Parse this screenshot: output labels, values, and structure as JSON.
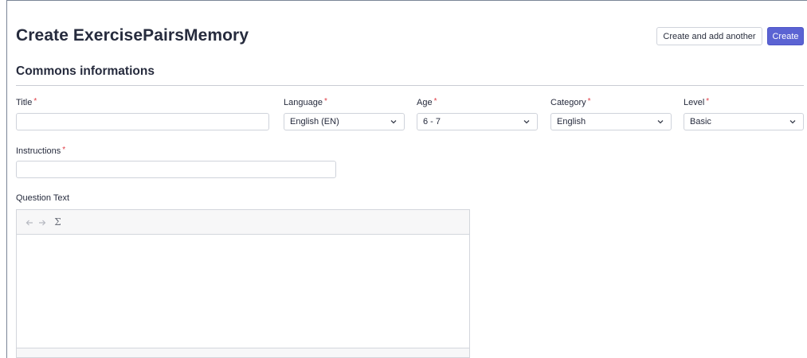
{
  "page": {
    "title": "Create ExercisePairsMemory"
  },
  "actions": {
    "create_and_add_another": "Create and add another",
    "create": "Create"
  },
  "section": {
    "title": "Commons informations"
  },
  "fields": {
    "title": {
      "label": "Title",
      "required_mark": "*",
      "value": ""
    },
    "language": {
      "label": "Language",
      "required_mark": "*",
      "value": "English (EN)"
    },
    "age": {
      "label": "Age",
      "required_mark": "*",
      "value": "6 - 7"
    },
    "category": {
      "label": "Category",
      "required_mark": "*",
      "value": "English"
    },
    "level": {
      "label": "Level",
      "required_mark": "*",
      "value": "Basic"
    },
    "instructions": {
      "label": "Instructions",
      "required_mark": "*",
      "value": ""
    },
    "question_text": {
      "label": "Question Text"
    }
  },
  "editor": {
    "toolbar": {
      "undo_icon": "undo-icon",
      "redo_icon": "redo-icon",
      "sigma": "Σ"
    }
  },
  "colors": {
    "primary": "#5b63d3",
    "required": "#e0404a",
    "text": "#262b3d"
  }
}
